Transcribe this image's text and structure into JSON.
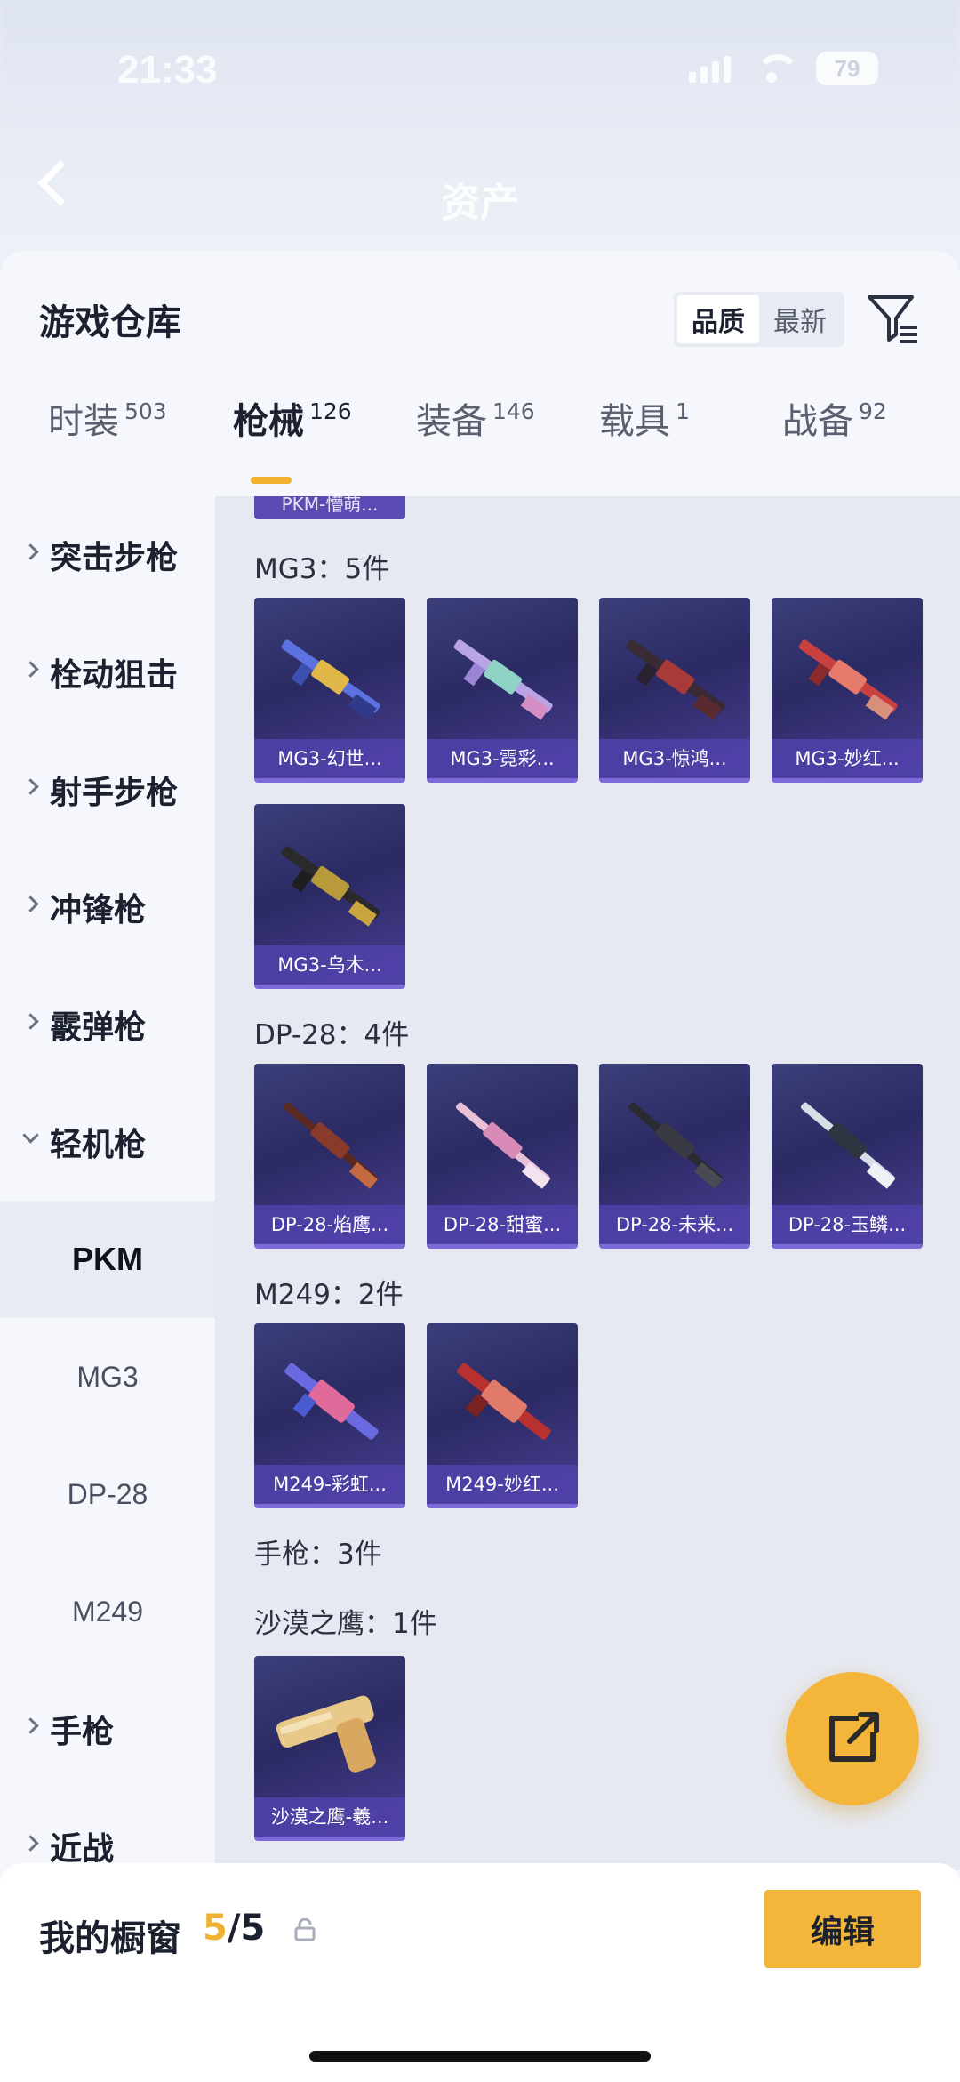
{
  "status_bar": {
    "time": "21:33",
    "battery": "79"
  },
  "header": {
    "title": "资产"
  },
  "sheet": {
    "title": "游戏仓库",
    "sort": {
      "quality": "品质",
      "latest": "最新"
    }
  },
  "tabs": [
    {
      "label": "时装",
      "count": "503"
    },
    {
      "label": "枪械",
      "count": "126"
    },
    {
      "label": "装备",
      "count": "146"
    },
    {
      "label": "载具",
      "count": "1"
    },
    {
      "label": "战备",
      "count": "92"
    }
  ],
  "sidebar": {
    "items": [
      "突击步枪",
      "栓动狙击",
      "射手步枪",
      "冲锋枪",
      "霰弹枪",
      "轻机枪"
    ],
    "subitems": [
      "PKM",
      "MG3",
      "DP-28",
      "M249"
    ],
    "items_after": [
      "手枪",
      "近战"
    ]
  },
  "main": {
    "partial_card": "PKM-懵萌...",
    "groups": {
      "mg3_title": "MG3：5件",
      "mg3_cards": [
        "MG3-幻世...",
        "MG3-霓彩...",
        "MG3-惊鸿...",
        "MG3-妙红...",
        "MG3-乌木..."
      ],
      "dp28_title": "DP-28：4件",
      "dp28_cards": [
        "DP-28-焰鹰...",
        "DP-28-甜蜜...",
        "DP-28-未来...",
        "DP-28-玉鳞..."
      ],
      "m249_title": "M249：2件",
      "m249_cards": [
        "M249-彩虹...",
        "M249-妙红..."
      ],
      "pistol_title": "手枪：3件",
      "deagle_title": "沙漠之鹰：1件",
      "deagle_cards": [
        "沙漠之鹰-羲..."
      ]
    }
  },
  "bottom": {
    "window_label": "我的橱窗",
    "current": "5",
    "total": "/5",
    "edit_label": "编辑"
  },
  "colors": {
    "accent": "#f3b53a",
    "card_bg": "#2b2a63",
    "card_caption": "#5042aa"
  }
}
